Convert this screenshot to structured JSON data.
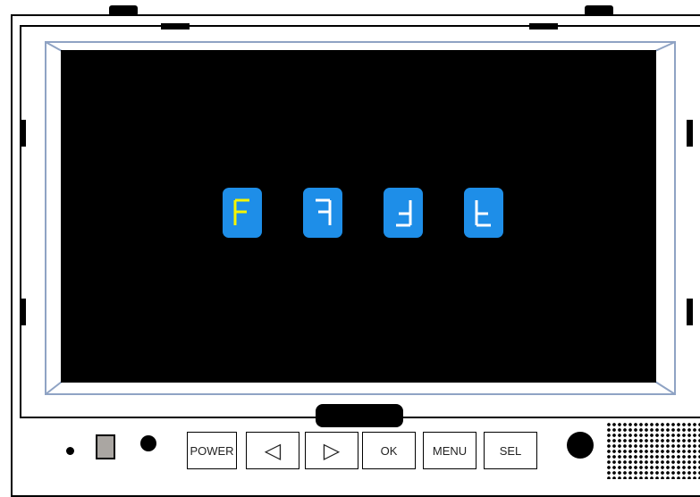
{
  "display": {
    "glyphs": [
      {
        "char": "F",
        "transform": "normal",
        "color": "#f5f500"
      },
      {
        "char": "F",
        "transform": "mirrored",
        "color": "#ffffff"
      },
      {
        "char": "F",
        "transform": "upside-down",
        "color": "#ffffff"
      },
      {
        "char": "F",
        "transform": "rotated-180",
        "color": "#ffffff"
      }
    ],
    "key_color": "#1e8ee8",
    "screen_color": "#000000"
  },
  "controls": {
    "power_label": "POWER",
    "left_arrow": "◁",
    "right_arrow": "▷",
    "ok_label": "OK",
    "menu_label": "MENU",
    "sel_label": "SEL"
  },
  "icons": {
    "left": "left-arrow-icon",
    "right": "right-arrow-icon"
  }
}
